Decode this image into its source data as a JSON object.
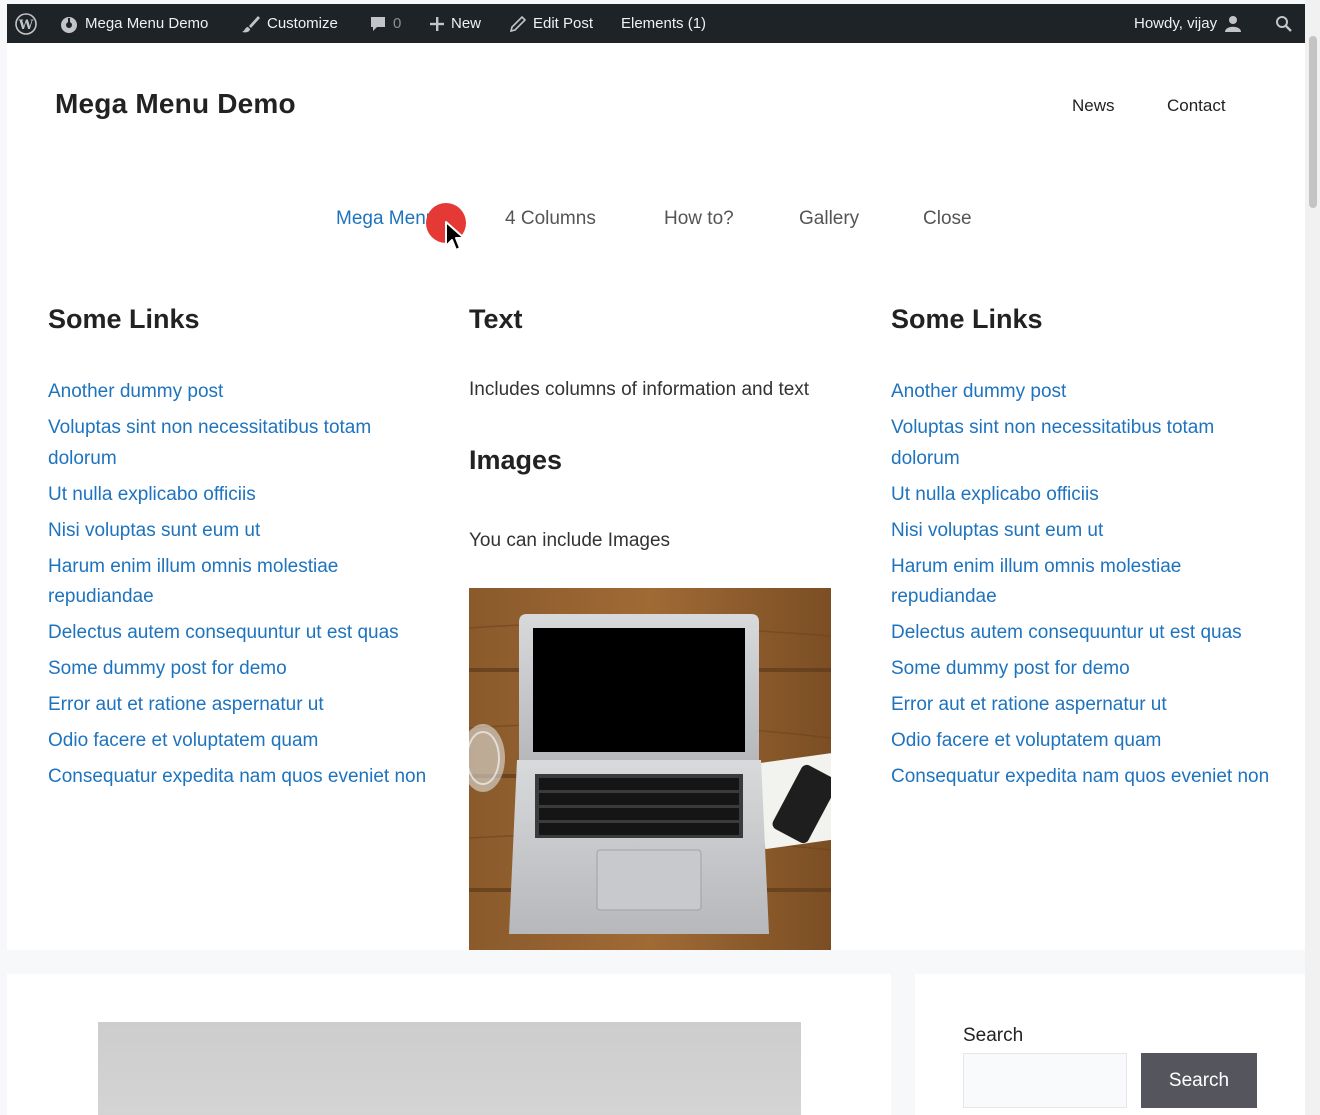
{
  "admin_bar": {
    "wp_logo_icon": "wordpress-logo-icon",
    "site_name": "Mega Menu Demo",
    "customize": "Customize",
    "comments_count": "0",
    "new": "New",
    "edit_post": "Edit Post",
    "elements": "Elements (1)",
    "howdy": "Howdy, vijay"
  },
  "header": {
    "site_title": "Mega Menu Demo",
    "nav": [
      "News",
      "Contact"
    ]
  },
  "mega_menu": {
    "items": [
      "Mega Menu",
      "4 Columns",
      "How to?",
      "Gallery",
      "Close"
    ],
    "active_index": 0
  },
  "panel": {
    "left": {
      "heading": "Some Links",
      "links": [
        "Another dummy post",
        "Voluptas sint non necessitatibus totam dolorum",
        "Ut nulla explicabo officiis",
        "Nisi voluptas sunt eum ut",
        "Harum enim illum omnis molestiae repudiandae",
        "Delectus autem consequuntur ut est quas",
        "Some dummy post for demo",
        "Error aut et ratione aspernatur ut",
        "Odio facere et voluptatem quam",
        "Consequatur expedita nam quos eveniet non"
      ]
    },
    "middle": {
      "heading": "Text",
      "text": "Includes columns of information and text",
      "images_heading": "Images",
      "images_text": "You can include Images"
    },
    "right": {
      "heading": "Some Links",
      "links": [
        "Another dummy post",
        "Voluptas sint non necessitatibus totam dolorum",
        "Ut nulla explicabo officiis",
        "Nisi voluptas sunt eum ut",
        "Harum enim illum omnis molestiae repudiandae",
        "Delectus autem consequuntur ut est quas",
        "Some dummy post for demo",
        "Error aut et ratione aspernatur ut",
        "Odio facere et voluptatem quam",
        "Consequatur expedita nam quos eveniet non"
      ]
    }
  },
  "sidebar": {
    "search_label": "Search",
    "search_button": "Search"
  },
  "colors": {
    "link": "#1e73be",
    "admin_bar_bg": "#1d2327",
    "button_bg": "#55555e"
  }
}
